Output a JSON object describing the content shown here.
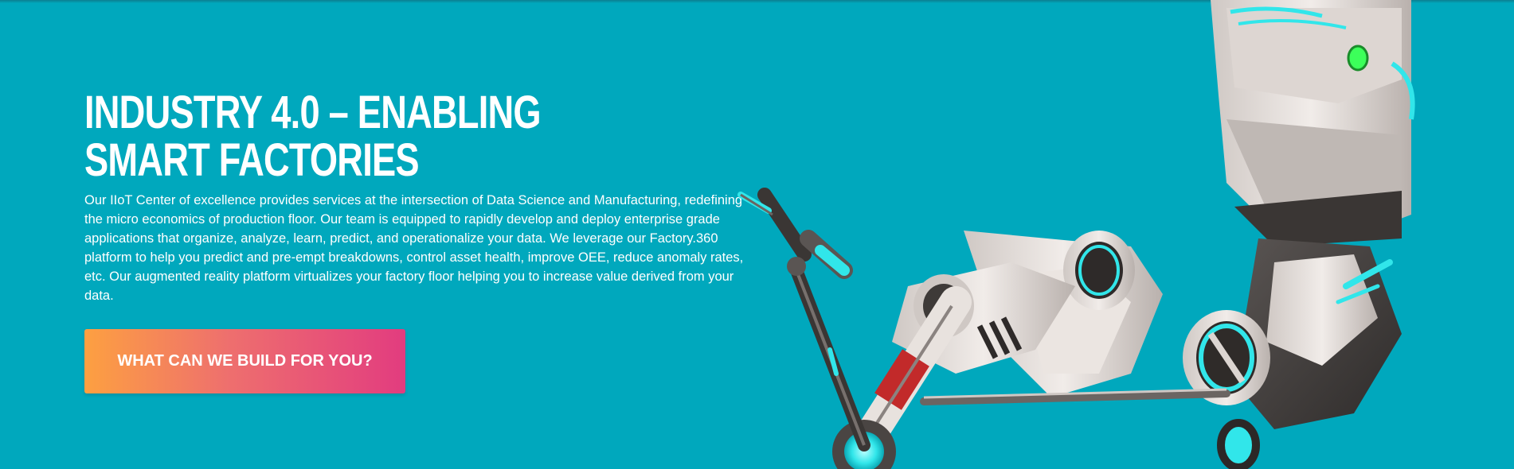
{
  "hero": {
    "title": "INDUSTRY 4.0 – ENABLING SMART FACTORIES",
    "description": "Our IIoT Center of excellence provides services at the intersection of Data Science and Manufacturing, redefining the micro economics of production floor. Our team is equipped to rapidly develop and deploy enterprise grade applications that organize, analyze, learn, predict, and operationalize your data. We leverage our Factory.360 platform to help you predict and pre-empt breakdowns, control asset health, improve OEE, reduce anomaly rates, etc. Our augmented reality platform virtualizes your factory floor helping you to increase value derived from your data.",
    "cta_label": "WHAT CAN WE BUILD FOR YOU?"
  },
  "theme": {
    "background": "#00a8bd",
    "cta_gradient_start": "#fda041",
    "cta_gradient_end": "#e23c7f",
    "robot_glow": "#31e6ea",
    "robot_led": "#3cff5a"
  },
  "illustration": {
    "icon": "robot-arm-illustration"
  }
}
